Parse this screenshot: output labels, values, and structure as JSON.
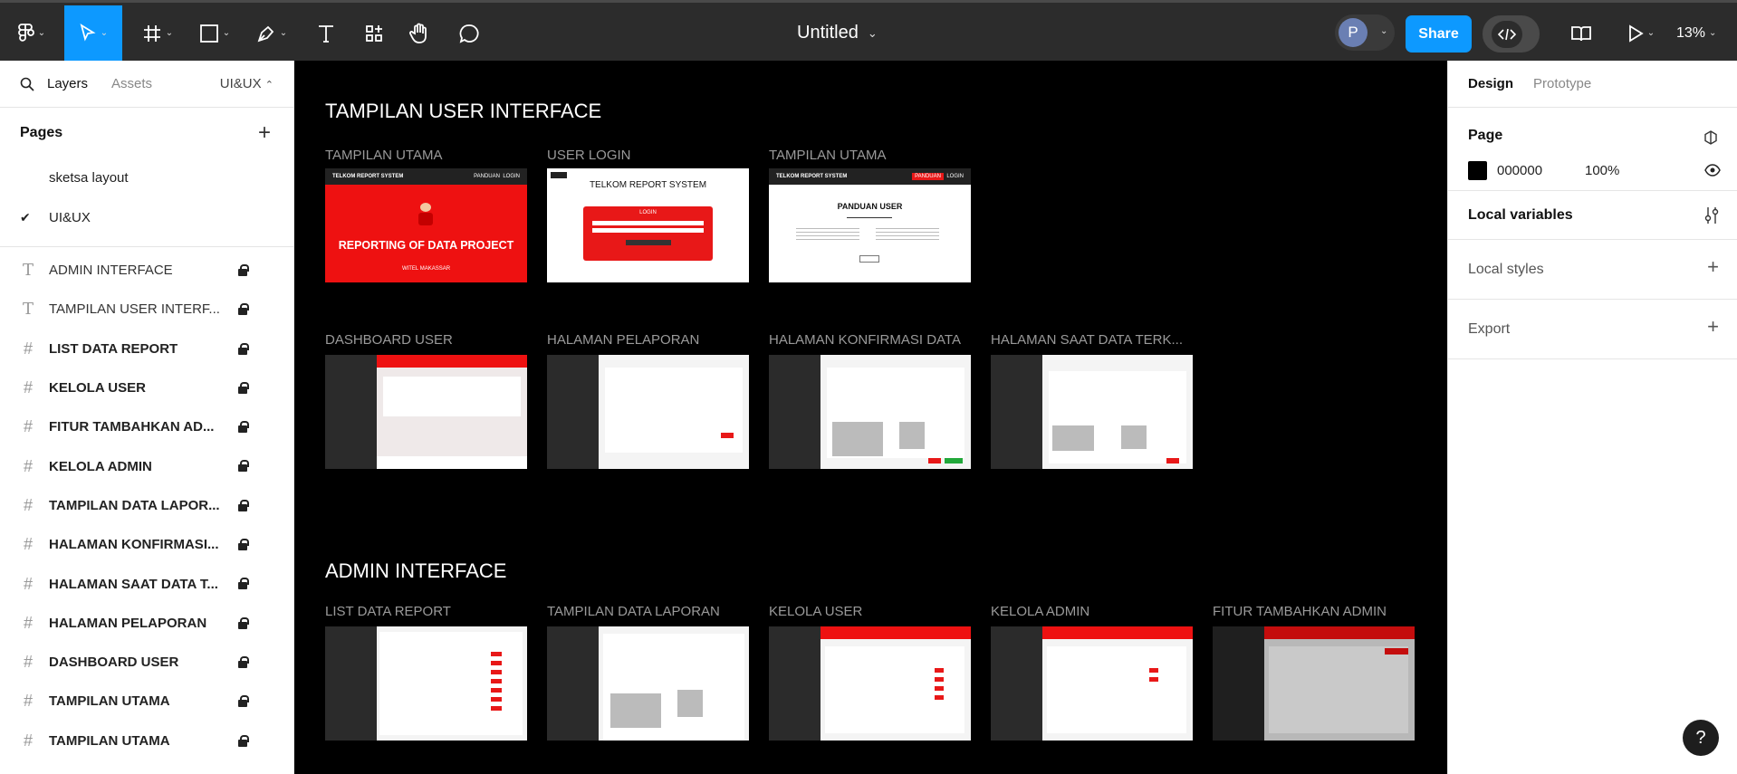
{
  "toolbar": {
    "document_title": "Untitled",
    "share_label": "Share",
    "avatar_initial": "P",
    "zoom": "13%"
  },
  "left_panel": {
    "tabs": {
      "layers": "Layers",
      "assets": "Assets"
    },
    "current_page": "UI&UX",
    "pages_header": "Pages",
    "pages": [
      {
        "name": "sketsa layout",
        "selected": false
      },
      {
        "name": "UI&UX",
        "selected": true
      }
    ],
    "layers": [
      {
        "name": "ADMIN INTERFACE",
        "kind": "text"
      },
      {
        "name": "TAMPILAN USER INTERF...",
        "kind": "text"
      },
      {
        "name": "LIST DATA REPORT",
        "kind": "frame"
      },
      {
        "name": "KELOLA USER",
        "kind": "frame"
      },
      {
        "name": "FITUR TAMBAHKAN AD...",
        "kind": "frame"
      },
      {
        "name": "KELOLA ADMIN",
        "kind": "frame"
      },
      {
        "name": "TAMPILAN DATA LAPOR...",
        "kind": "frame"
      },
      {
        "name": "HALAMAN KONFIRMASI...",
        "kind": "frame"
      },
      {
        "name": "HALAMAN SAAT DATA T...",
        "kind": "frame"
      },
      {
        "name": "HALAMAN PELAPORAN",
        "kind": "frame"
      },
      {
        "name": "DASHBOARD USER",
        "kind": "frame"
      },
      {
        "name": "TAMPILAN UTAMA",
        "kind": "frame"
      },
      {
        "name": "TAMPILAN UTAMA",
        "kind": "frame"
      }
    ]
  },
  "canvas": {
    "sections": {
      "user": "TAMPILAN USER INTERFACE",
      "admin": "ADMIN INTERFACE"
    },
    "frames": {
      "f1": "TAMPILAN UTAMA",
      "f2": "USER LOGIN",
      "f3": "TAMPILAN UTAMA",
      "f4": "DASHBOARD USER",
      "f5": "HALAMAN PELAPORAN",
      "f6": "HALAMAN KONFIRMASI DATA",
      "f7": "HALAMAN SAAT DATA TERK...",
      "f8": "LIST DATA REPORT",
      "f9": "TAMPILAN DATA LAPORAN",
      "f10": "KELOLA USER",
      "f11": "KELOLA ADMIN",
      "f12": "FITUR TAMBAHKAN ADMIN"
    },
    "thumb_text": {
      "brand": "TELKOM REPORT SYSTEM",
      "nav_guide": "PANDUAN",
      "nav_login": "LOGIN",
      "hero_title": "REPORTING OF DATA PROJECT",
      "hero_sub": "WITEL MAKASSAR",
      "login_title": "TELKOM REPORT SYSTEM",
      "login_box": "LOGIN",
      "guide_title": "PANDUAN USER"
    }
  },
  "right_panel": {
    "tabs": {
      "design": "Design",
      "prototype": "Prototype"
    },
    "page_label": "Page",
    "page_color": "000000",
    "page_opacity": "100%",
    "local_variables": "Local variables",
    "local_styles": "Local styles",
    "export": "Export"
  },
  "colors": {
    "accent": "#0d99ff",
    "toolbar_bg": "#2c2c2c",
    "telkom_red": "#ee1111"
  }
}
